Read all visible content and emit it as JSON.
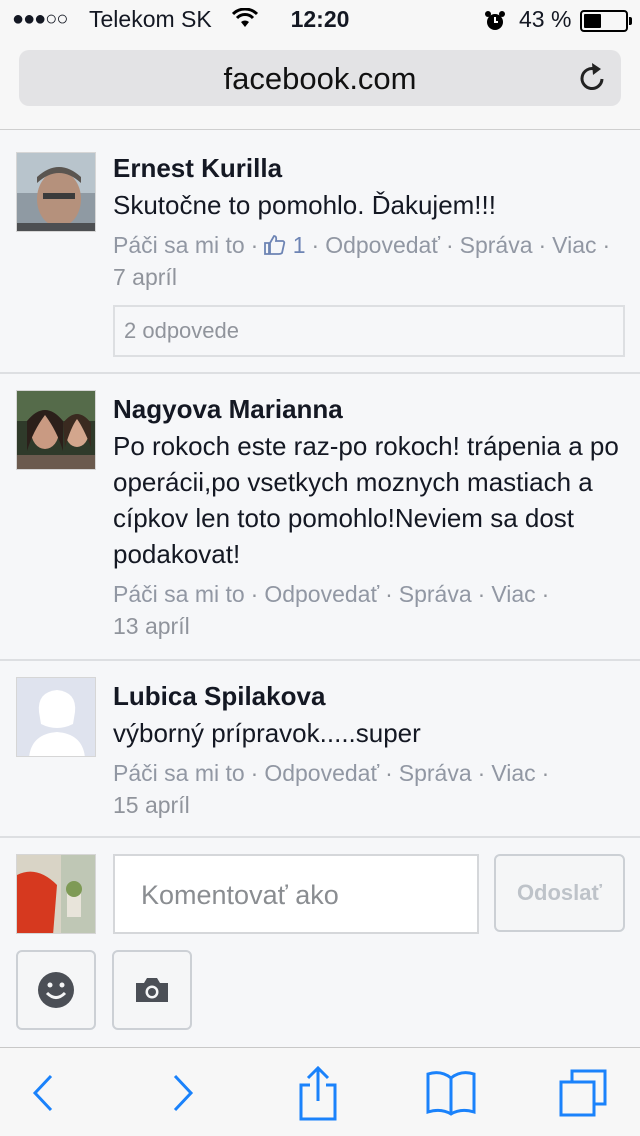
{
  "status_bar": {
    "signal": "●●●○○",
    "carrier": "Telekom SK",
    "time": "12:20",
    "battery_text": "43 %",
    "battery_level": 0.43
  },
  "browser": {
    "url": "facebook.com"
  },
  "comments": [
    {
      "author": "Ernest Kurilla",
      "text": "Skutočne to pomohlo. Ďakujem!!!",
      "like_label": "Páči sa mi to",
      "like_count": "1",
      "reply_label": "Odpovedať",
      "message_label": "Správa",
      "more_label": "Viac",
      "date": "7 apríl",
      "replies_label": "2 odpovede"
    },
    {
      "author": "Nagyova Marianna",
      "text": "Po rokoch este raz-po rokoch! trápenia a po operácii,po vsetkych moznych mastiach a cípkov len toto pomohlo!Neviem sa dost podakovat!",
      "like_label": "Páči sa mi to",
      "reply_label": "Odpovedať",
      "message_label": "Správa",
      "more_label": "Viac",
      "date": "13 apríl"
    },
    {
      "author": "Lubica Spilakova",
      "text": "výborný prípravok.....super",
      "like_label": "Páči sa mi to",
      "reply_label": "Odpovedať",
      "message_label": "Správa",
      "more_label": "Viac",
      "date": "15 apríl"
    }
  ],
  "composer": {
    "placeholder": "Komentovať ako",
    "send_label": "Odoslať"
  },
  "toolbar_icons": [
    "back-icon",
    "forward-icon",
    "share-icon",
    "bookmarks-icon",
    "tabs-icon"
  ],
  "colors": {
    "link": "#90949c",
    "like_accent": "#6d84b4",
    "ios_blue": "#1a82fb"
  }
}
